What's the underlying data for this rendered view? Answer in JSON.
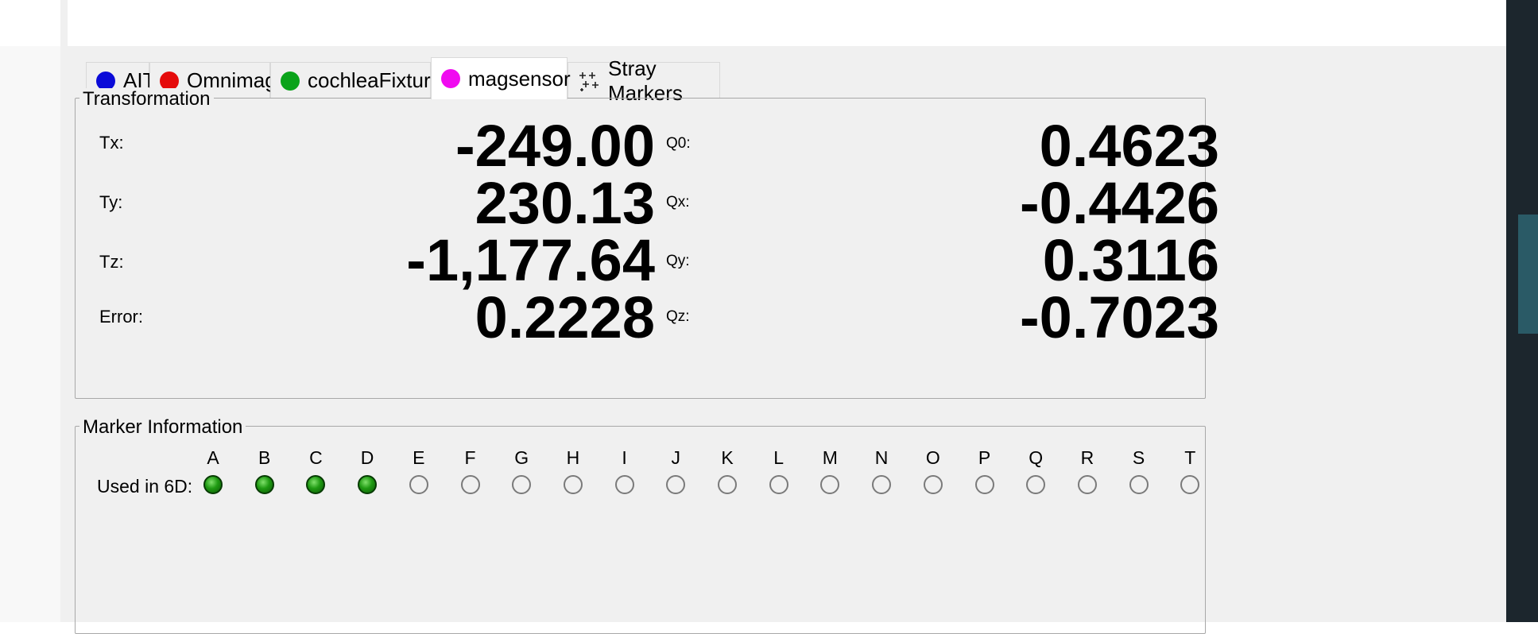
{
  "tabs": [
    {
      "label": "AIT",
      "color": "#0b0bd8",
      "active": false
    },
    {
      "label": "Omnimag",
      "color": "#e50b0b",
      "active": false
    },
    {
      "label": "cochleaFixture",
      "color": "#0aa31a",
      "active": false
    },
    {
      "label": "magsensor",
      "color": "#f00af0",
      "active": true
    },
    {
      "label": "Stray Markers",
      "icon": "stray-markers-icon",
      "active": false
    }
  ],
  "transformation": {
    "title": "Transformation",
    "rows": [
      {
        "label": "Tx:",
        "value": "-249.00",
        "q_label": "Q0:",
        "q_value": "0.4623"
      },
      {
        "label": "Ty:",
        "value": "230.13",
        "q_label": "Qx:",
        "q_value": "-0.4426"
      },
      {
        "label": "Tz:",
        "value": "-1,177.64",
        "q_label": "Qy:",
        "q_value": "0.3116"
      },
      {
        "label": "Error:",
        "value": "0.2228",
        "q_label": "Qz:",
        "q_value": "-0.7023"
      }
    ]
  },
  "markers": {
    "title": "Marker Information",
    "row_label": "Used in 6D:",
    "letters": [
      "A",
      "B",
      "C",
      "D",
      "E",
      "F",
      "G",
      "H",
      "I",
      "J",
      "K",
      "L",
      "M",
      "N",
      "O",
      "P",
      "Q",
      "R",
      "S",
      "T"
    ],
    "used": [
      true,
      true,
      true,
      true,
      false,
      false,
      false,
      false,
      false,
      false,
      false,
      false,
      false,
      false,
      false,
      false,
      false,
      false,
      false,
      false
    ]
  },
  "colors": {
    "led_on": "#1f9a12",
    "panel_bg": "#f0f0f0"
  }
}
